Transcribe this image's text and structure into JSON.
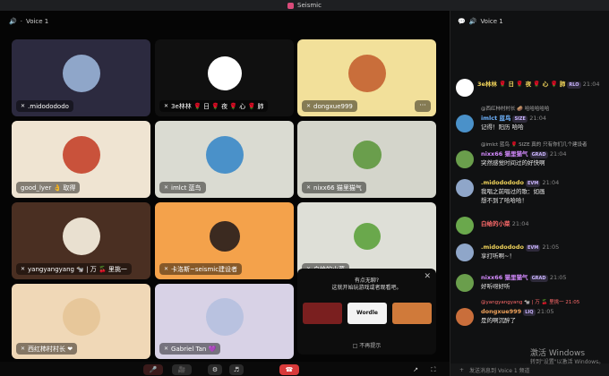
{
  "app": {
    "title": "Seismic"
  },
  "stage": {
    "channel": "Voice 1",
    "channel_prefix": "·"
  },
  "tiles": [
    {
      "name": ".midodododo",
      "bg": "#2c2a3f"
    },
    {
      "name": "3e林林 🌹 日 🌹 夜 🌹 心 🌹 肺",
      "bg": "#101010"
    },
    {
      "name": "dongxue999",
      "bg": "#f2e09a"
    },
    {
      "name": "good_lyer 👌 取得",
      "bg": "#efe4d2"
    },
    {
      "name": "imlct 蓝鸟",
      "bg": "#dadbd2"
    },
    {
      "name": "nixx66 猫里猫气",
      "bg": "#d4d5cb"
    },
    {
      "name": "yangyangyang 🐄 | 万 🍒 里挑一",
      "bg": "#4a2f22"
    },
    {
      "name": "卡洛斯~seismic建设者",
      "bg": "#f4a24b"
    },
    {
      "name": "白给的小菜",
      "bg": "#dedfd7"
    },
    {
      "name": "西红柿村村长 ❤",
      "bg": "#f0d8b7"
    },
    {
      "name": "Gabriel Tan 💜",
      "bg": "#d8d2e6"
    }
  ],
  "promo": {
    "line1": "有点无聊?",
    "line2": "这就开始玩游戏或者观看吧。",
    "games": [
      "",
      "Wordle",
      ""
    ],
    "dont_show": "不再提示"
  },
  "sidebar": {
    "channel": "Voice 1",
    "composer_placeholder": "发送消息到 Voice 1 频道"
  },
  "messages": [
    {
      "type": "name_only",
      "name": "3e林林 🌹 日 🌹 夜 🌹 心 🌹 肺",
      "badge": "RLO",
      "time": "21:04",
      "color": "#f0d35a"
    },
    {
      "type": "reply",
      "reply": "@西红柿村村长 🥔 哈哈哈哈哈"
    },
    {
      "type": "msg",
      "name": "imlct 蓝鸟",
      "badge": "SIZE",
      "time": "21:04",
      "text": "记得！阳历 哈哈",
      "color": "#6fb4ff"
    },
    {
      "type": "reply",
      "reply": "@imlct 蓝鸟 🌹 SIZE 真的 只有你们几个建设者"
    },
    {
      "type": "msg",
      "name": "nixx66 猫里猫气",
      "badge": "GRAD",
      "time": "21:04",
      "text": "突然感觉时间过的好快啊",
      "color": "#d58bff"
    },
    {
      "type": "msg",
      "name": ".midodododo",
      "badge": "EVM",
      "time": "21:04",
      "text": "我唱之前唱过的歌：如画",
      "text2": "想不到了哈哈哈！",
      "color": "#f0d35a"
    },
    {
      "type": "name_only",
      "name": "白给的小菜",
      "badge": "",
      "time": "21:04",
      "color": "#ff6b6b"
    },
    {
      "type": "msg",
      "name": ".midodododo",
      "badge": "EVM",
      "time": "21:05",
      "text": "享打听啊~！",
      "color": "#f0d35a"
    },
    {
      "type": "msg",
      "name": "nixx66 猫里猫气",
      "badge": "GRAD",
      "time": "21:05",
      "text": "好听呀好听",
      "color": "#d58bff"
    },
    {
      "type": "reply",
      "reply": "@yangyangyang 🐄 | 万 🍒 里挑一 21:05"
    },
    {
      "type": "msg",
      "name": "dongxue999",
      "badge": "LIQ",
      "time": "21:05",
      "text": "是的啊沉醉了",
      "color": "#f0a25a"
    }
  ],
  "watermark": {
    "line1": "激活 Windows",
    "line2": "转到\"设置\"以激活 Windows。"
  }
}
